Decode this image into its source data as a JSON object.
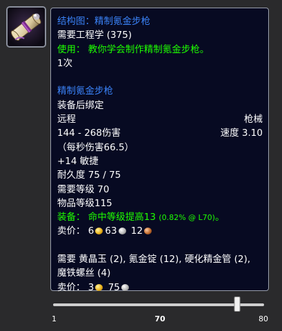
{
  "item_icon": "scroll-schematic-icon",
  "tooltip": {
    "title": "结构图：精制氪金步枪",
    "requires_skill": "需要工程学 (375)",
    "use_text": "使用： 教你学会制作精制氪金步枪。",
    "count": "1次",
    "product_name": "精制氪金步枪",
    "bind": "装备后绑定",
    "slot": "远程",
    "weapon_type": "枪械",
    "damage": "144 - 268伤害",
    "speed": "速度 3.10",
    "dps": "（每秒伤害66.5）",
    "stat": "+14 敏捷",
    "durability": "耐久度 75 / 75",
    "req_level": "需要等级 70",
    "item_level": "物品等级115",
    "equip_prefix": "装备： 命中等级提高13",
    "equip_detail": "(0.82% @ L70)",
    "equip_suffix": "。",
    "sell_label": "卖价：",
    "product_price": {
      "gold": "6",
      "silver": "63",
      "copper": "12"
    },
    "reagents_line1": "需要 黄晶玉 (2), 氪金锭 (12), 硬化精金管 (2),",
    "reagents_line2": "魔铁螺丝 (4)",
    "schematic_price": {
      "gold": "3",
      "silver": "75"
    }
  },
  "level_slider": {
    "min_label": "1",
    "value_label": "70",
    "max_label": "80",
    "min": 1,
    "max": 80,
    "value": 70
  },
  "colors": {
    "title_blue": "#3a82f7",
    "use_green": "#1eff00",
    "tooltip_bg": "#070a22",
    "tooltip_border": "#9aa0ad"
  }
}
